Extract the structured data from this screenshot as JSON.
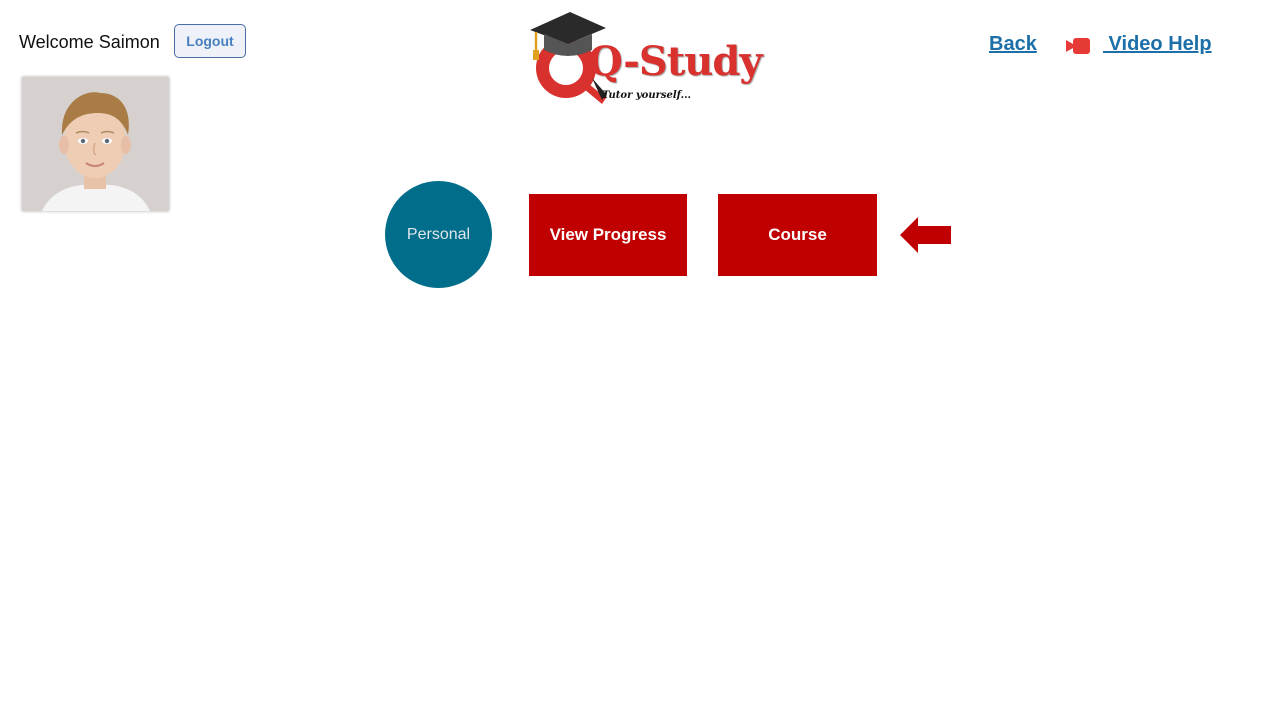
{
  "header": {
    "welcome_text": "Welcome Saimon",
    "logout_label": "Logout",
    "back_label": "Back",
    "video_help_label": " Video Help"
  },
  "logo": {
    "brand": "Q-Study",
    "tagline": "Tutor yourself..."
  },
  "main": {
    "personal_label": "Personal",
    "view_progress_label": "View Progress",
    "course_label": "Course"
  },
  "colors": {
    "primary_red": "#c00000",
    "personal_teal": "#006e8a",
    "link_blue": "#1c6fa8",
    "logo_red": "#d8312e"
  },
  "icons": {
    "video": "video-camera-icon",
    "arrow": "left-arrow-icon",
    "cap": "graduation-cap-icon"
  }
}
